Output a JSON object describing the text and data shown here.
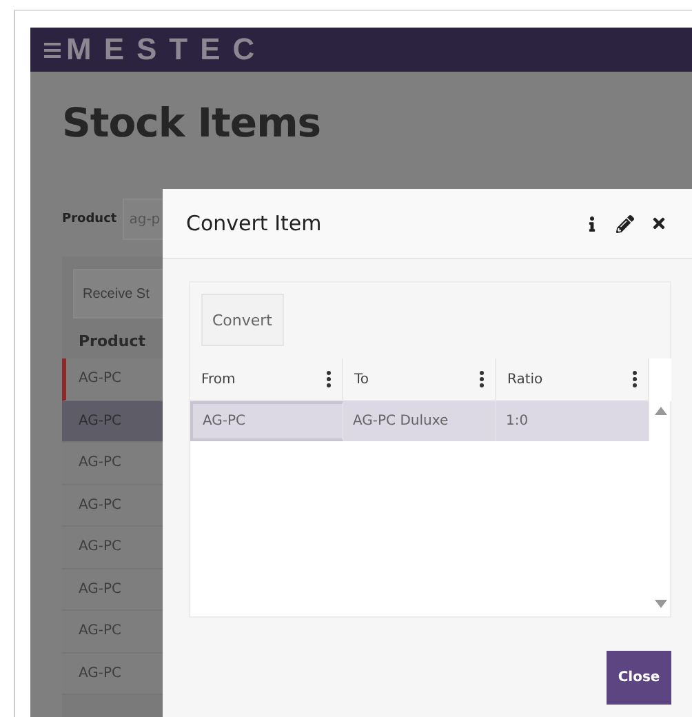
{
  "header": {
    "logo": "MESTEC"
  },
  "page": {
    "title": "Stock Items",
    "filter_label": "Product",
    "filter_value": "ag-p",
    "action_button": "Receive St",
    "column": "Product",
    "rows": [
      {
        "text": "AG-PC",
        "selected": false,
        "flagged": true
      },
      {
        "text": "AG-PC",
        "selected": true,
        "flagged": false
      },
      {
        "text": "AG-PC",
        "selected": false,
        "flagged": false
      },
      {
        "text": "AG-PC",
        "selected": false,
        "flagged": false
      },
      {
        "text": "AG-PC",
        "selected": false,
        "flagged": false
      },
      {
        "text": "AG-PC",
        "selected": false,
        "flagged": false
      },
      {
        "text": "AG-PC",
        "selected": false,
        "flagged": false
      },
      {
        "text": "AG-PC",
        "selected": false,
        "flagged": false
      }
    ]
  },
  "dialog": {
    "title": "Convert Item",
    "toolbar_button": "Convert",
    "columns": [
      "From",
      "To",
      "Ratio"
    ],
    "rows": [
      {
        "selected": true,
        "cells": [
          {
            "text": "AG-PC",
            "focused": true
          },
          {
            "text": "AG-PC Duluxe",
            "focused": false
          },
          {
            "text": "1:0",
            "focused": false
          }
        ]
      }
    ],
    "close_button": "Close"
  }
}
